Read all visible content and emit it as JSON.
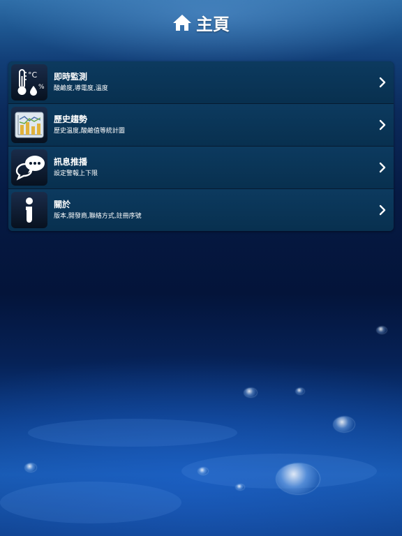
{
  "header": {
    "title": "主頁",
    "icon": "home-icon"
  },
  "menu": {
    "items": [
      {
        "title": "即時監測",
        "subtitle": "酸鹼度,導電度,溫度",
        "icon": "thermometer-icon"
      },
      {
        "title": "歷史趨勢",
        "subtitle": "歷史溫度,酸鹼值等統計圖",
        "icon": "trend-chart-icon"
      },
      {
        "title": "訊息推播",
        "subtitle": "設定警報上下限",
        "icon": "chat-bubble-icon"
      },
      {
        "title": "關於",
        "subtitle": "版本,開發商,聯絡方式,註冊序號",
        "icon": "info-icon"
      }
    ]
  },
  "icon_labels": {
    "celsius": "°C",
    "percent": "%"
  },
  "colors": {
    "row": "#0a3456",
    "text": "#ffffff"
  }
}
